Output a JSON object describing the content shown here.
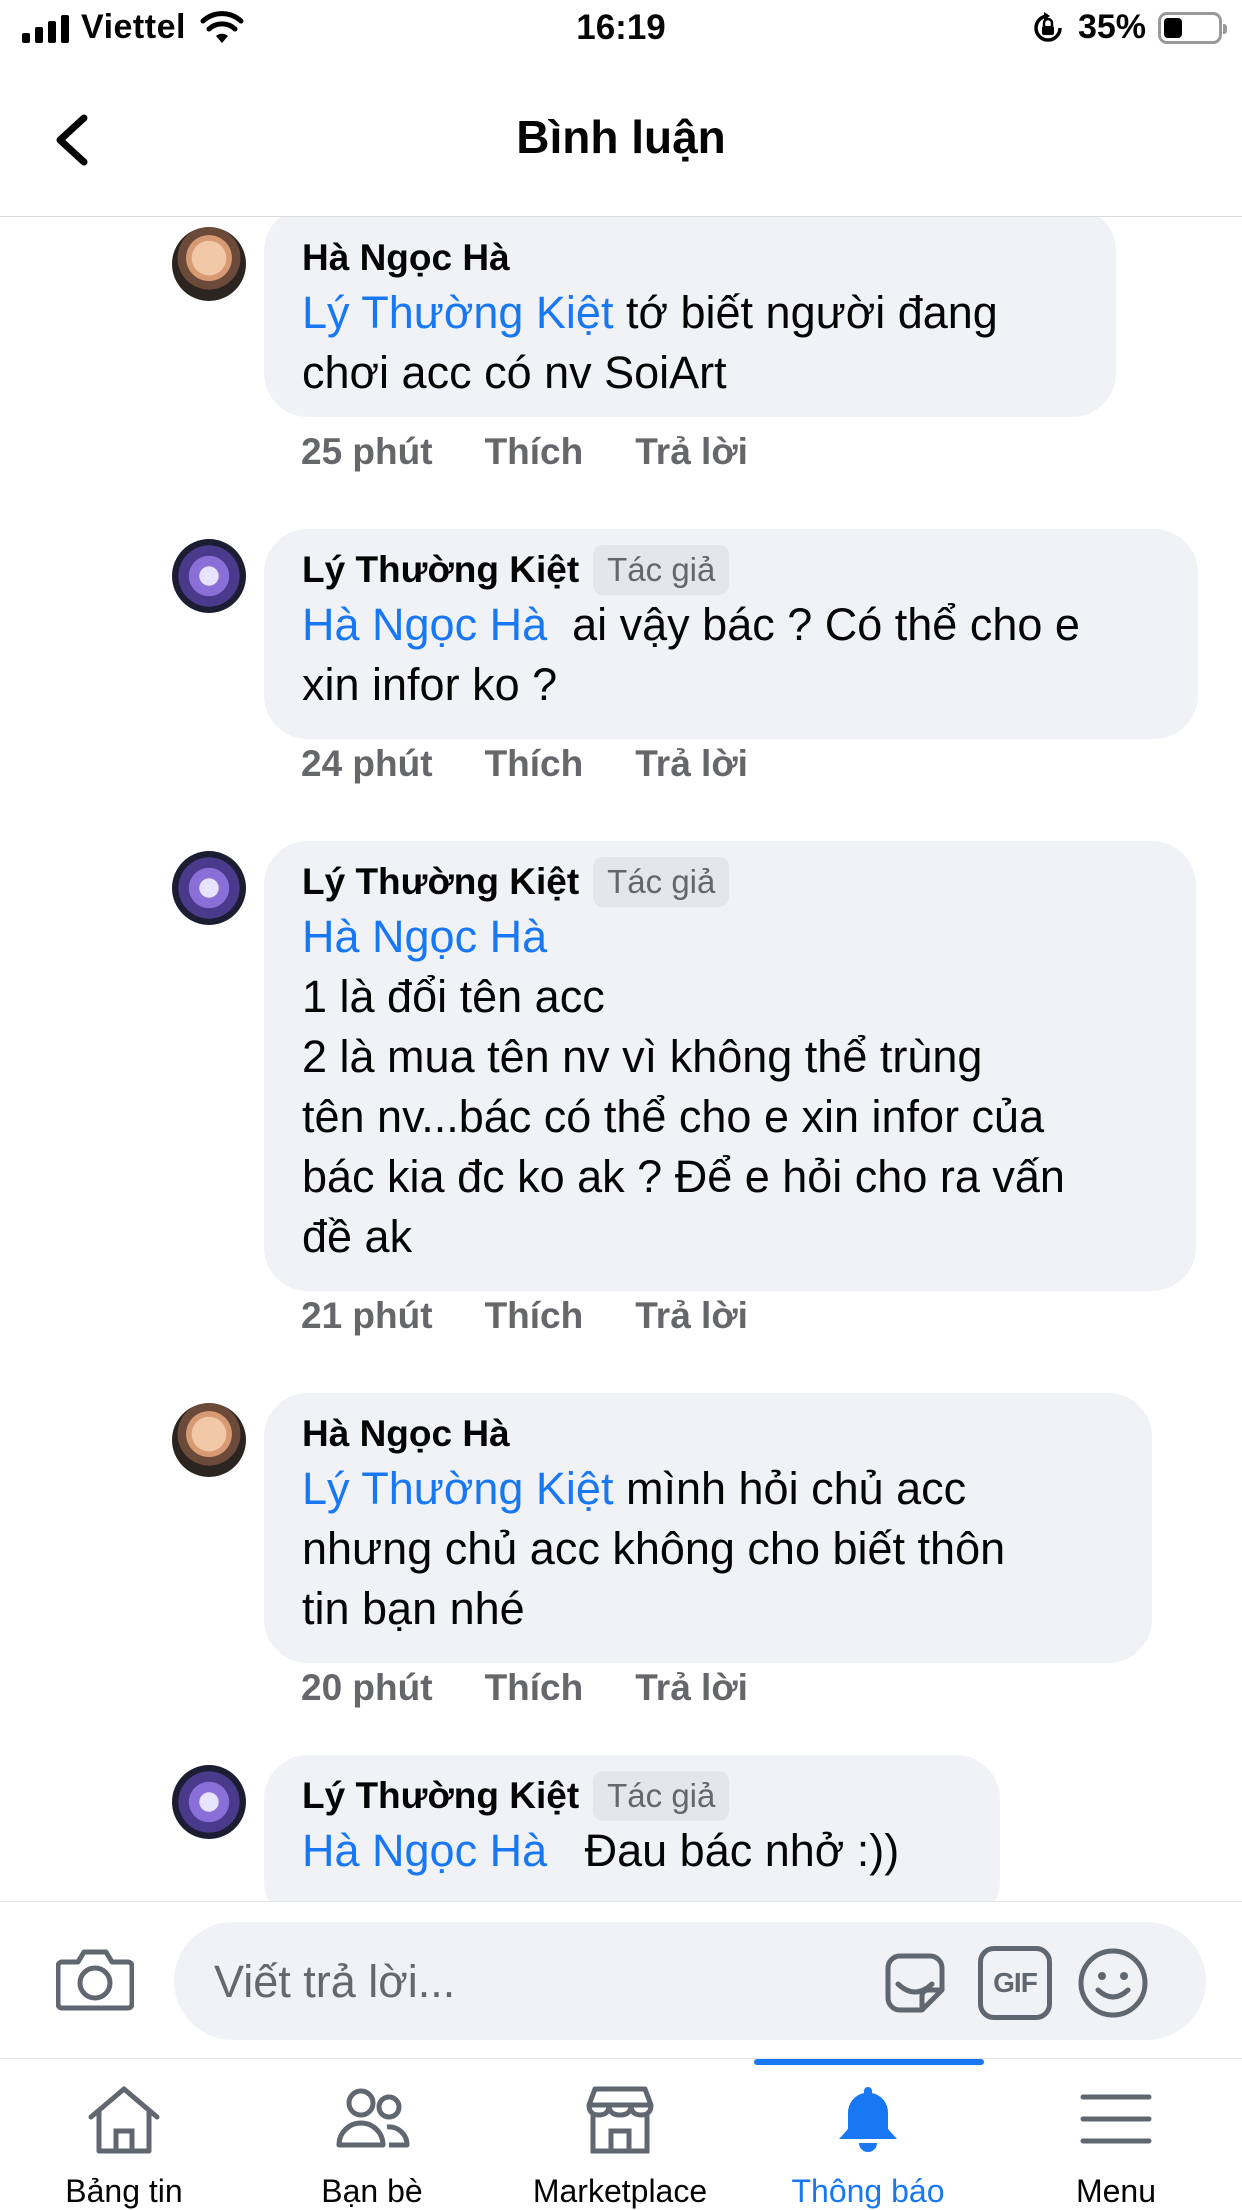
{
  "status_bar": {
    "carrier": "Viettel",
    "time": "16:19",
    "battery_percent": "35%",
    "battery_level": 0.35
  },
  "header": {
    "title": "Bình luận",
    "back_icon": "chevron-left-icon"
  },
  "comments": [
    {
      "author": "Hà Ngọc Hà",
      "badge": "",
      "mention": "Lý Thường Kiệt",
      "lines": [
        " tớ biết người đang",
        "chơi acc có nv SoiArt"
      ],
      "time": "25 phút",
      "like": "Thích",
      "reply": "Trả lời"
    },
    {
      "author": "Lý Thường Kiệt",
      "badge": "Tác giả",
      "mention": "Hà Ngọc Hà",
      "lines": [
        "  ai vậy bác ? Có thể cho e",
        "xin infor ko ?"
      ],
      "time": "24 phút",
      "like": "Thích",
      "reply": "Trả lời"
    },
    {
      "author": "Lý Thường Kiệt",
      "badge": "Tác giả",
      "mention": "Hà Ngọc Hà",
      "lines": [
        "",
        "1 là đổi tên acc",
        "2 là mua tên nv vì không thể trùng",
        "tên nv...bác có thể cho e xin infor của",
        "bác kia đc ko ak ? Để e hỏi cho ra vấn",
        "đề ak"
      ],
      "time": "21 phút",
      "like": "Thích",
      "reply": "Trả lời"
    },
    {
      "author": "Hà Ngọc Hà",
      "badge": "",
      "mention": "Lý Thường Kiệt",
      "lines": [
        " mình hỏi chủ acc",
        "nhưng chủ acc không cho biết thôn",
        "tin bạn nhé"
      ],
      "time": "20 phút",
      "like": "Thích",
      "reply": "Trả lời"
    },
    {
      "author": "Lý Thường Kiệt",
      "badge": "Tác giả",
      "mention": "Hà Ngọc Hà",
      "lines": [
        "   Đau bác nhở :))"
      ],
      "time": "",
      "like": "",
      "reply": ""
    }
  ],
  "composer": {
    "placeholder": "Viết trả lời...",
    "camera_icon": "camera-icon",
    "sticker_icon": "sticker-icon",
    "gif_label": "GIF",
    "emoji_icon": "emoji-icon"
  },
  "tabs": [
    {
      "label": "Bảng tin",
      "icon": "home-icon",
      "active": false
    },
    {
      "label": "Bạn bè",
      "icon": "friends-icon",
      "active": false
    },
    {
      "label": "Marketplace",
      "icon": "marketplace-icon",
      "active": false
    },
    {
      "label": "Thông báo",
      "icon": "bell-icon",
      "active": true
    },
    {
      "label": "Menu",
      "icon": "menu-icon",
      "active": false
    }
  ],
  "colors": {
    "accent": "#1877f2",
    "bubble": "#f0f2f5",
    "muted": "#65676b"
  }
}
